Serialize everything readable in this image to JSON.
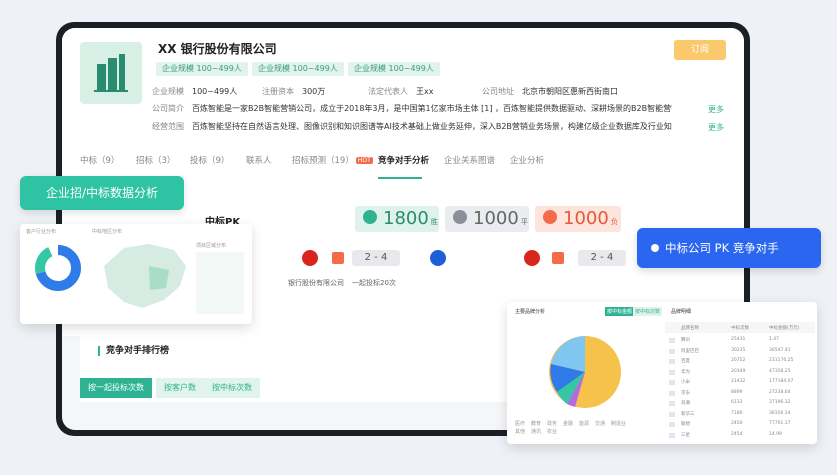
{
  "company": {
    "name": "XX 银行股份有限公司",
    "follow_label": "订阅",
    "tags": [
      "企业规模 100~499人",
      "企业规模 100~499人",
      "企业规模 100~499人"
    ],
    "scale_label": "企业规模",
    "scale_value": "100~499人",
    "capital_label": "注册资本",
    "capital_value": "300万",
    "rep_label": "法定代表人",
    "rep_value": "王xx",
    "address_label": "公司地址",
    "address_value": "北京市朝阳区惠新西街南口",
    "intro_label": "公司简介",
    "intro_value": "百炼智能是一家B2B智能营销公司，成立于2018年3月，是中国第1亿家市场主体 [1] ，百炼智能提供数据驱动、深耕场景的B2B智能营销...",
    "scope_label": "经营范围",
    "scope_value": "百炼智能坚持在自然语言处理、图像识别和知识图谱等AI技术基础上做业务延伸，深入B2B营销业务场景，构建亿级企业数据库及行业知识...",
    "more_label": "更多"
  },
  "tabs": [
    {
      "label": "中标（9）"
    },
    {
      "label": "招标（3）"
    },
    {
      "label": "投标（9）"
    },
    {
      "label": "联系人"
    },
    {
      "label": "招标预测（19）",
      "badge": "HOT"
    },
    {
      "label": "竞争对手分析"
    },
    {
      "label": "企业关系图谱"
    },
    {
      "label": "企业分析"
    }
  ],
  "callouts": {
    "left": "企业招/中标数据分析",
    "right": "中标公司 PK 竞争对手"
  },
  "pk": {
    "label": "中标PK",
    "scores": [
      {
        "value": "1800",
        "unit": "胜",
        "color": "#2db391"
      },
      {
        "value": "1000",
        "unit": "平",
        "color": "#8a8f99"
      },
      {
        "value": "1000",
        "unit": "负",
        "color": "#f46b4a"
      }
    ],
    "matches": [
      {
        "score": "2 - 4",
        "team": "银行股份有限公司",
        "note": "一起投标20次"
      },
      {
        "score": "2 - 4"
      }
    ]
  },
  "ranking": {
    "title": "竞争对手排行榜",
    "tabs": [
      "按一起投标次数",
      "按客户数",
      "按中标次数"
    ]
  },
  "left_panel": {
    "donut_title": "客户行业分布",
    "map_title": "中标地区分布",
    "list_title": "项目区域分布"
  },
  "right_panel": {
    "pie_title": "主要品牌分析",
    "pie_tabs": [
      "按中标金额",
      "按中标次数"
    ],
    "pie_legend": [
      "医疗",
      "教育",
      "政务",
      "金融",
      "能源",
      "交通",
      "制造业",
      "其他",
      "通讯",
      "农业"
    ],
    "table_title": "品牌明细",
    "table_headers": [
      "品牌名称",
      "中标次数",
      "中标金额(万元)"
    ],
    "table_rows": [
      {
        "name": "腾讯",
        "count": "25431",
        "amount": "1.47"
      },
      {
        "name": "阿里巴巴",
        "count": "30235",
        "amount": "36547.41"
      },
      {
        "name": "百度",
        "count": "20752",
        "amount": "231176.25"
      },
      {
        "name": "华为",
        "count": "20349",
        "amount": "47358.25"
      },
      {
        "name": "小米",
        "count": "21432",
        "amount": "177184.07"
      },
      {
        "name": "京东",
        "count": "8899",
        "amount": "27238.64"
      },
      {
        "name": "浪潮",
        "count": "6133",
        "amount": "37196.32"
      },
      {
        "name": "新华三",
        "count": "7180",
        "amount": "36356.14"
      },
      {
        "name": "联想",
        "count": "2450",
        "amount": "77791.17"
      },
      {
        "name": "三星",
        "count": "2454",
        "amount": "14.99"
      }
    ]
  }
}
